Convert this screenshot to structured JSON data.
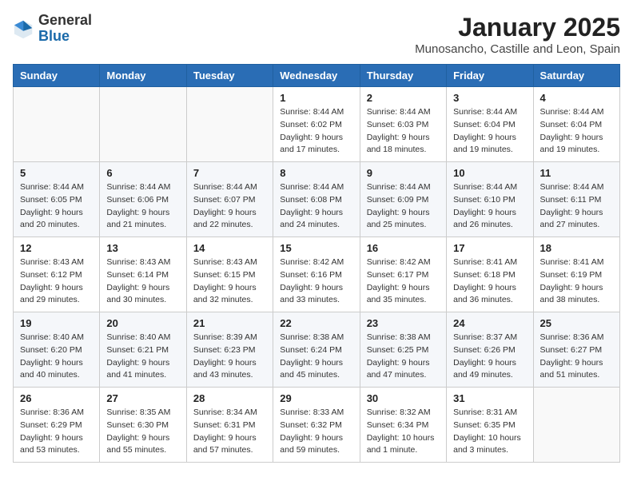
{
  "logo": {
    "general": "General",
    "blue": "Blue"
  },
  "header": {
    "month": "January 2025",
    "location": "Munosancho, Castille and Leon, Spain"
  },
  "days_of_week": [
    "Sunday",
    "Monday",
    "Tuesday",
    "Wednesday",
    "Thursday",
    "Friday",
    "Saturday"
  ],
  "weeks": [
    [
      {
        "day": "",
        "info": ""
      },
      {
        "day": "",
        "info": ""
      },
      {
        "day": "",
        "info": ""
      },
      {
        "day": "1",
        "info": "Sunrise: 8:44 AM\nSunset: 6:02 PM\nDaylight: 9 hours\nand 17 minutes."
      },
      {
        "day": "2",
        "info": "Sunrise: 8:44 AM\nSunset: 6:03 PM\nDaylight: 9 hours\nand 18 minutes."
      },
      {
        "day": "3",
        "info": "Sunrise: 8:44 AM\nSunset: 6:04 PM\nDaylight: 9 hours\nand 19 minutes."
      },
      {
        "day": "4",
        "info": "Sunrise: 8:44 AM\nSunset: 6:04 PM\nDaylight: 9 hours\nand 19 minutes."
      }
    ],
    [
      {
        "day": "5",
        "info": "Sunrise: 8:44 AM\nSunset: 6:05 PM\nDaylight: 9 hours\nand 20 minutes."
      },
      {
        "day": "6",
        "info": "Sunrise: 8:44 AM\nSunset: 6:06 PM\nDaylight: 9 hours\nand 21 minutes."
      },
      {
        "day": "7",
        "info": "Sunrise: 8:44 AM\nSunset: 6:07 PM\nDaylight: 9 hours\nand 22 minutes."
      },
      {
        "day": "8",
        "info": "Sunrise: 8:44 AM\nSunset: 6:08 PM\nDaylight: 9 hours\nand 24 minutes."
      },
      {
        "day": "9",
        "info": "Sunrise: 8:44 AM\nSunset: 6:09 PM\nDaylight: 9 hours\nand 25 minutes."
      },
      {
        "day": "10",
        "info": "Sunrise: 8:44 AM\nSunset: 6:10 PM\nDaylight: 9 hours\nand 26 minutes."
      },
      {
        "day": "11",
        "info": "Sunrise: 8:44 AM\nSunset: 6:11 PM\nDaylight: 9 hours\nand 27 minutes."
      }
    ],
    [
      {
        "day": "12",
        "info": "Sunrise: 8:43 AM\nSunset: 6:12 PM\nDaylight: 9 hours\nand 29 minutes."
      },
      {
        "day": "13",
        "info": "Sunrise: 8:43 AM\nSunset: 6:14 PM\nDaylight: 9 hours\nand 30 minutes."
      },
      {
        "day": "14",
        "info": "Sunrise: 8:43 AM\nSunset: 6:15 PM\nDaylight: 9 hours\nand 32 minutes."
      },
      {
        "day": "15",
        "info": "Sunrise: 8:42 AM\nSunset: 6:16 PM\nDaylight: 9 hours\nand 33 minutes."
      },
      {
        "day": "16",
        "info": "Sunrise: 8:42 AM\nSunset: 6:17 PM\nDaylight: 9 hours\nand 35 minutes."
      },
      {
        "day": "17",
        "info": "Sunrise: 8:41 AM\nSunset: 6:18 PM\nDaylight: 9 hours\nand 36 minutes."
      },
      {
        "day": "18",
        "info": "Sunrise: 8:41 AM\nSunset: 6:19 PM\nDaylight: 9 hours\nand 38 minutes."
      }
    ],
    [
      {
        "day": "19",
        "info": "Sunrise: 8:40 AM\nSunset: 6:20 PM\nDaylight: 9 hours\nand 40 minutes."
      },
      {
        "day": "20",
        "info": "Sunrise: 8:40 AM\nSunset: 6:21 PM\nDaylight: 9 hours\nand 41 minutes."
      },
      {
        "day": "21",
        "info": "Sunrise: 8:39 AM\nSunset: 6:23 PM\nDaylight: 9 hours\nand 43 minutes."
      },
      {
        "day": "22",
        "info": "Sunrise: 8:38 AM\nSunset: 6:24 PM\nDaylight: 9 hours\nand 45 minutes."
      },
      {
        "day": "23",
        "info": "Sunrise: 8:38 AM\nSunset: 6:25 PM\nDaylight: 9 hours\nand 47 minutes."
      },
      {
        "day": "24",
        "info": "Sunrise: 8:37 AM\nSunset: 6:26 PM\nDaylight: 9 hours\nand 49 minutes."
      },
      {
        "day": "25",
        "info": "Sunrise: 8:36 AM\nSunset: 6:27 PM\nDaylight: 9 hours\nand 51 minutes."
      }
    ],
    [
      {
        "day": "26",
        "info": "Sunrise: 8:36 AM\nSunset: 6:29 PM\nDaylight: 9 hours\nand 53 minutes."
      },
      {
        "day": "27",
        "info": "Sunrise: 8:35 AM\nSunset: 6:30 PM\nDaylight: 9 hours\nand 55 minutes."
      },
      {
        "day": "28",
        "info": "Sunrise: 8:34 AM\nSunset: 6:31 PM\nDaylight: 9 hours\nand 57 minutes."
      },
      {
        "day": "29",
        "info": "Sunrise: 8:33 AM\nSunset: 6:32 PM\nDaylight: 9 hours\nand 59 minutes."
      },
      {
        "day": "30",
        "info": "Sunrise: 8:32 AM\nSunset: 6:34 PM\nDaylight: 10 hours\nand 1 minute."
      },
      {
        "day": "31",
        "info": "Sunrise: 8:31 AM\nSunset: 6:35 PM\nDaylight: 10 hours\nand 3 minutes."
      },
      {
        "day": "",
        "info": ""
      }
    ]
  ]
}
